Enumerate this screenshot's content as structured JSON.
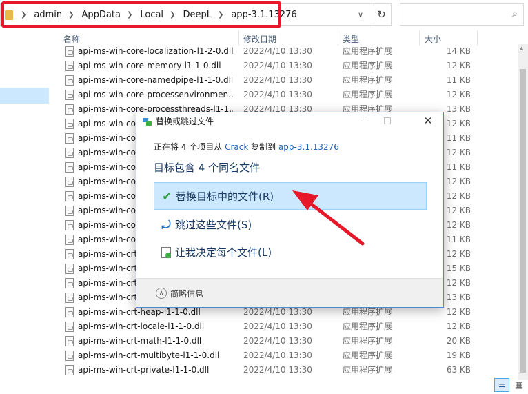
{
  "address_bar": {
    "crumbs": [
      "admin",
      "AppData",
      "Local",
      "DeepL",
      "app-3.1.13276"
    ],
    "separator_icon": "chevron-right-icon",
    "dropdown_icon": "chevron-down-icon",
    "refresh_icon": "refresh-icon",
    "search_icon": "search-icon"
  },
  "columns": {
    "name": "名称",
    "date": "修改日期",
    "type": "类型",
    "size": "大小"
  },
  "files": [
    {
      "name": "api-ms-win-core-localization-l1-2-0.dll",
      "date": "2022/4/10 13:30",
      "type": "应用程序扩展",
      "size": "14 KB"
    },
    {
      "name": "api-ms-win-core-memory-l1-1-0.dll",
      "date": "2022/4/10 13:30",
      "type": "应用程序扩展",
      "size": "12 KB"
    },
    {
      "name": "api-ms-win-core-namedpipe-l1-1-0.dll",
      "date": "2022/4/10 13:30",
      "type": "应用程序扩展",
      "size": "11 KB"
    },
    {
      "name": "api-ms-win-core-processenvironmen...",
      "date": "2022/4/10 13:30",
      "type": "应用程序扩展",
      "size": "12 KB"
    },
    {
      "name": "api-ms-win-core-processthreads-l1-1...",
      "date": "2022/4/10 13:30",
      "type": "应用程序扩展",
      "size": "13 KB"
    },
    {
      "name": "api-ms-win-cor",
      "date": "",
      "type": "",
      "size": "12 KB"
    },
    {
      "name": "api-ms-win-cor",
      "date": "",
      "type": "",
      "size": "11 KB"
    },
    {
      "name": "api-ms-win-cor",
      "date": "",
      "type": "",
      "size": "12 KB"
    },
    {
      "name": "api-ms-win-cor",
      "date": "",
      "type": "",
      "size": "11 KB"
    },
    {
      "name": "api-ms-win-cor",
      "date": "",
      "type": "",
      "size": "12 KB"
    },
    {
      "name": "api-ms-win-cor",
      "date": "",
      "type": "",
      "size": "12 KB"
    },
    {
      "name": "api-ms-win-cor",
      "date": "",
      "type": "",
      "size": "12 KB"
    },
    {
      "name": "api-ms-win-cor",
      "date": "",
      "type": "",
      "size": "12 KB"
    },
    {
      "name": "api-ms-win-cor",
      "date": "",
      "type": "",
      "size": "11 KB"
    },
    {
      "name": "api-ms-win-crt",
      "date": "",
      "type": "",
      "size": "12 KB"
    },
    {
      "name": "api-ms-win-crt",
      "date": "",
      "type": "",
      "size": "15 KB"
    },
    {
      "name": "api-ms-win-crt",
      "date": "",
      "type": "",
      "size": "12 KB"
    },
    {
      "name": "api-ms-win-crt",
      "date": "",
      "type": "",
      "size": "13 KB"
    },
    {
      "name": "api-ms-win-crt-heap-l1-1-0.dll",
      "date": "2022/4/10 13:30",
      "type": "应用程序扩展",
      "size": "12 KB"
    },
    {
      "name": "api-ms-win-crt-locale-l1-1-0.dll",
      "date": "2022/4/10 13:30",
      "type": "应用程序扩展",
      "size": "12 KB"
    },
    {
      "name": "api-ms-win-crt-math-l1-1-0.dll",
      "date": "2022/4/10 13:30",
      "type": "应用程序扩展",
      "size": "20 KB"
    },
    {
      "name": "api-ms-win-crt-multibyte-l1-1-0.dll",
      "date": "2022/4/10 13:30",
      "type": "应用程序扩展",
      "size": "19 KB"
    },
    {
      "name": "api-ms-win-crt-private-l1-1-0.dll",
      "date": "2022/4/10 13:30",
      "type": "应用程序扩展",
      "size": "63 KB"
    }
  ],
  "dialog": {
    "title": "替换或跳过文件",
    "copy_prefix": "正在将 4 个项目从 ",
    "copy_source": "Crack",
    "copy_middle": " 复制到 ",
    "copy_dest": "app-3.1.13276",
    "heading": "目标包含 4 个同名文件",
    "option_replace": "替换目标中的文件(R)",
    "option_skip": "跳过这些文件(S)",
    "option_decide": "让我决定每个文件(L)",
    "more_info": "简略信息",
    "minimize_icon": "minimize-icon",
    "maximize_icon": "maximize-icon",
    "close_icon": "close-icon"
  },
  "colors": {
    "annotation_red": "#e8182b",
    "selection_blue": "#cce8ff",
    "link_blue": "#1f62b8"
  }
}
